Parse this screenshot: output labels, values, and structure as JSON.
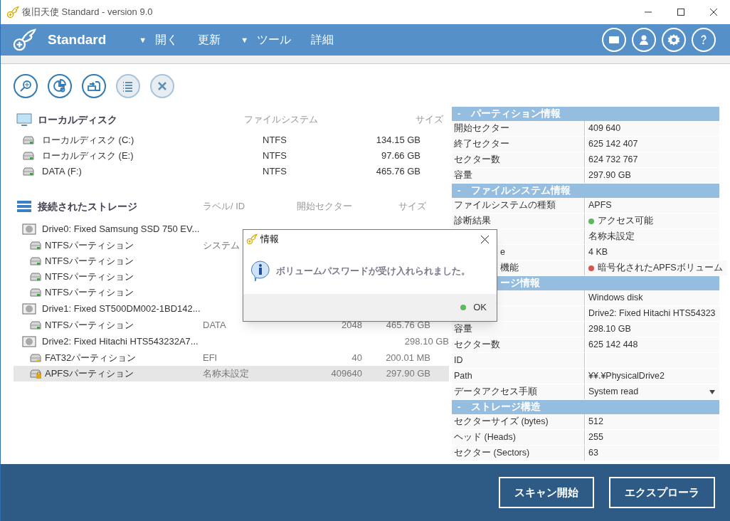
{
  "window": {
    "title": "復旧天使 Standard - version 9.0"
  },
  "header": {
    "brand": "Standard",
    "menu": [
      {
        "caret": "▼",
        "label": "開く"
      },
      {
        "label": "更新"
      },
      {
        "caret": "▼",
        "label": "ツール"
      },
      {
        "label": "詳細"
      }
    ]
  },
  "toolbar": [
    {
      "kind": "search",
      "disabled": false
    },
    {
      "kind": "chart",
      "disabled": false
    },
    {
      "kind": "transfer",
      "disabled": false
    },
    {
      "kind": "list",
      "disabled": true
    },
    {
      "kind": "close",
      "disabled": true
    }
  ],
  "local_disks": {
    "title": "ローカルディスク",
    "columns": [
      "ファイルシステム",
      "サイズ"
    ],
    "rows": [
      {
        "name": "ローカルディスク (C:)",
        "fs": "NTFS",
        "size": "134.15 GB"
      },
      {
        "name": "ローカルディスク (E:)",
        "fs": "NTFS",
        "size": "97.66 GB"
      },
      {
        "name": "DATA (F:)",
        "fs": "NTFS",
        "size": "465.76 GB"
      }
    ]
  },
  "storage": {
    "title": "接続されたストレージ",
    "columns": [
      "ラベル/ ID",
      "開始セクター",
      "サイズ"
    ],
    "drives": [
      {
        "name": "Drive0: Fixed Samsung SSD 750 EV...",
        "selected": false,
        "children": [
          {
            "name": "NTFSパーティション",
            "kind": "normal",
            "label": "システム",
            "selected": false
          },
          {
            "name": "NTFSパーティション",
            "kind": "normal",
            "selected": false
          },
          {
            "name": "NTFSパーティション",
            "kind": "normal",
            "selected": false
          },
          {
            "name": "NTFSパーティション",
            "kind": "normal",
            "selected": false
          }
        ]
      },
      {
        "name": "Drive1: Fixed ST500DM002-1BD142...",
        "selected": false,
        "children": [
          {
            "name": "NTFSパーティション",
            "kind": "normal",
            "label": "DATA",
            "start": "2048",
            "size": "465.76 GB",
            "selected": false
          }
        ]
      },
      {
        "name": "Drive2: Fixed Hitachi HTS543232A7...",
        "size": "298.10 GB",
        "selected": false,
        "children": [
          {
            "name": "FAT32パーティション",
            "kind": "efi",
            "label": "EFI",
            "start": "40",
            "size": "200.01 MB",
            "selected": false
          },
          {
            "name": "APFSパーティション",
            "kind": "locked",
            "label": "名称未設定",
            "start": "409640",
            "size": "297.90 GB",
            "selected": true
          }
        ]
      }
    ]
  },
  "properties": [
    {
      "toggle": "-",
      "title": "パーティション情報",
      "rows": [
        {
          "label": "開始セクター",
          "value": "409 640"
        },
        {
          "label": "終了セクター",
          "value": "625 142 407"
        },
        {
          "label": "セクター数",
          "value": "624 732 767"
        },
        {
          "label": "容量",
          "value": "297.90 GB"
        }
      ]
    },
    {
      "toggle": "-",
      "title": "ファイルシステム情報",
      "rows": [
        {
          "label": "ファイルシステムの種類",
          "value": "APFS"
        },
        {
          "label": "診断結果",
          "value": "アクセス可能",
          "color": "#5cb85c"
        },
        {
          "covered": true,
          "value": "名称未設定"
        },
        {
          "covered": true,
          "label": "e",
          "value": "4 KB"
        },
        {
          "covered": true,
          "label": "機能",
          "value": "暗号化されたAPFSボリューム",
          "color": "#d9534f"
        }
      ]
    },
    {
      "covered": true,
      "title": "ージ情報",
      "rows": [
        {
          "covered": true,
          "value": "Windows disk"
        },
        {
          "covered": true,
          "value": "Drive2: Fixed Hitachi HTS54323"
        },
        {
          "label": "容量",
          "value": "298.10 GB"
        },
        {
          "label": "セクター数",
          "value": "625 142 448"
        },
        {
          "label": "ID"
        },
        {
          "label": "Path",
          "value": "¥¥.¥PhysicalDrive2"
        },
        {
          "label": "データアクセス手順",
          "value": "System read",
          "kind": "dropdown"
        }
      ]
    },
    {
      "toggle": "-",
      "title": "ストレージ構造",
      "rows": [
        {
          "label": "セクターサイズ (bytes)",
          "value": "512"
        },
        {
          "label": "ヘッド (Heads)",
          "value": "255"
        },
        {
          "label": "セクター (Sectors)",
          "value": "63"
        }
      ]
    }
  ],
  "dialog": {
    "title": "情報",
    "message": "ボリュームパスワードが受け入れられました。",
    "button": "OK"
  },
  "buttons": [
    "スキャン開始",
    "エクスプローラ"
  ]
}
